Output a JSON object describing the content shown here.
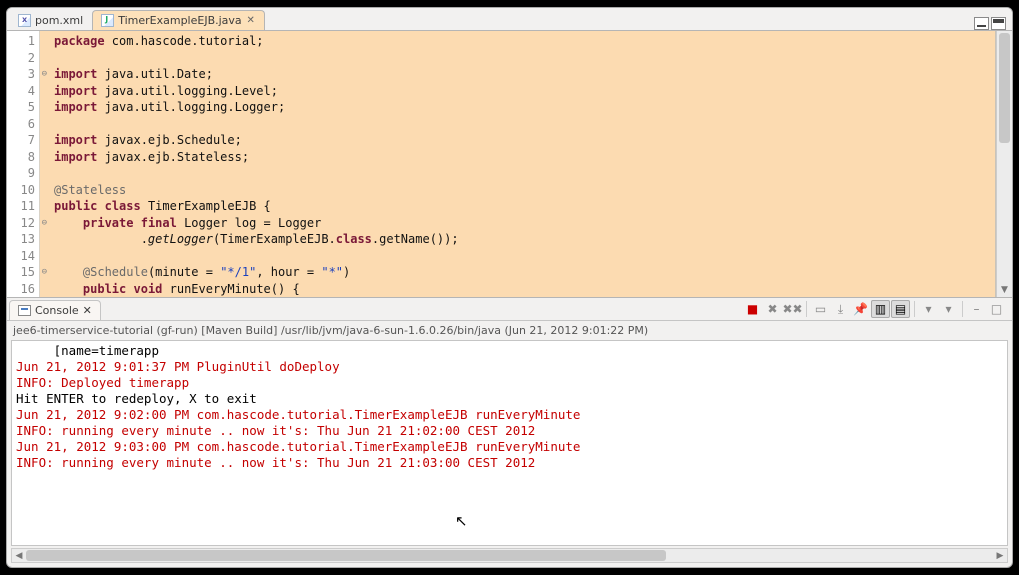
{
  "tabs": [
    {
      "label": "pom.xml",
      "active": false,
      "iconKind": "xml"
    },
    {
      "label": "TimerExampleEJB.java",
      "active": true,
      "iconKind": "java"
    }
  ],
  "editor": {
    "lineNumbers": [
      "1",
      "2",
      "3",
      "4",
      "5",
      "6",
      "7",
      "8",
      "9",
      "10",
      "11",
      "12",
      "13",
      "14",
      "15",
      "16"
    ],
    "foldLines": [
      3,
      12,
      15
    ],
    "code": {
      "l1_kw": "package",
      "l1_rest": " com.hascode.tutorial;",
      "l3_kw": "import",
      "l3_rest": " java.util.Date;",
      "l4_kw": "import",
      "l4_rest": " java.util.logging.Level;",
      "l5_kw": "import",
      "l5_rest": " java.util.logging.Logger;",
      "l7_kw": "import",
      "l7_rest": " javax.ejb.Schedule;",
      "l8_kw": "import",
      "l8_rest": " javax.ejb.Stateless;",
      "l10_ann": "@Stateless",
      "l11_kw1": "public",
      "l11_kw2": "class",
      "l11_rest": " TimerExampleEJB {",
      "l12_indent": "    ",
      "l12_kw1": "private",
      "l12_kw2": "final",
      "l12_rest": " Logger log = Logger",
      "l13_indent": "            .",
      "l13_mtd": "getLogger",
      "l13_mid": "(TimerExampleEJB.",
      "l13_kw": "class",
      "l13_tail": ".getName());",
      "l15_indent": "    ",
      "l15_ann": "@Schedule",
      "l15_open": "(minute = ",
      "l15_str1": "\"*/1\"",
      "l15_mid": ", hour = ",
      "l15_str2": "\"*\"",
      "l15_close": ")",
      "l16_indent": "    ",
      "l16_kw1": "public",
      "l16_kw2": "void",
      "l16_rest": " runEveryMinute() {"
    }
  },
  "console": {
    "tabLabel": "Console",
    "status": "jee6-timerservice-tutorial (gf-run) [Maven Build] /usr/lib/jvm/java-6-sun-1.6.0.26/bin/java (Jun 21, 2012 9:01:22 PM)",
    "lines": [
      {
        "cls": "std",
        "text": "     [name=timerapp"
      },
      {
        "cls": "err",
        "text": "Jun 21, 2012 9:01:37 PM PluginUtil doDeploy"
      },
      {
        "cls": "err",
        "text": "INFO: Deployed timerapp"
      },
      {
        "cls": "std",
        "text": "Hit ENTER to redeploy, X to exit"
      },
      {
        "cls": "err",
        "text": "Jun 21, 2012 9:02:00 PM com.hascode.tutorial.TimerExampleEJB runEveryMinute"
      },
      {
        "cls": "err",
        "text": "INFO: running every minute .. now it's: Thu Jun 21 21:02:00 CEST 2012"
      },
      {
        "cls": "err",
        "text": "Jun 21, 2012 9:03:00 PM com.hascode.tutorial.TimerExampleEJB runEveryMinute"
      },
      {
        "cls": "err",
        "text": "INFO: running every minute .. now it's: Thu Jun 21 21:03:00 CEST 2012"
      }
    ],
    "toolbar": {
      "terminate": "■",
      "removeLaunch": "✖",
      "removeAll": "✖✖",
      "clear": "▭",
      "scrollLock": "⤓",
      "pin": "📌",
      "showConsole": "▥",
      "openConsole": "▤",
      "min": "–",
      "max": "□"
    }
  }
}
